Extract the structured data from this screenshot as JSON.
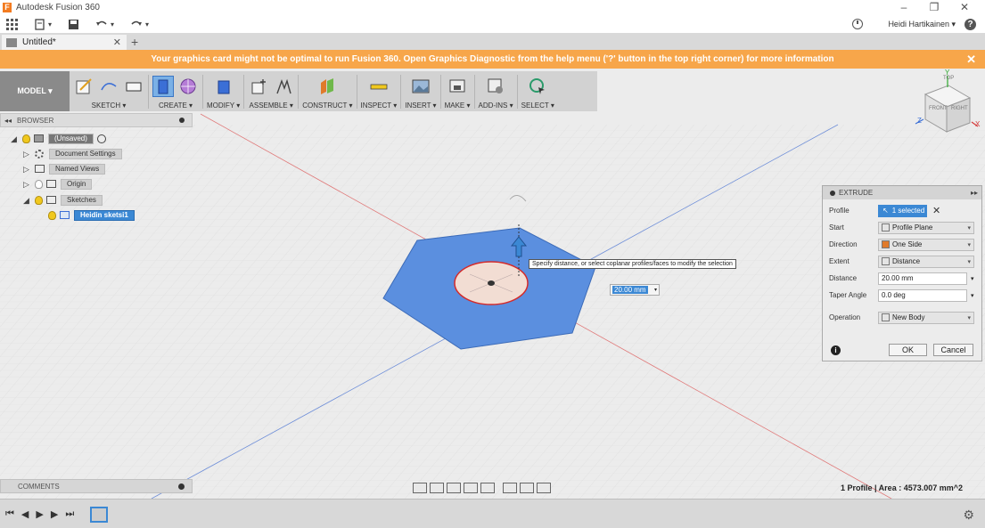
{
  "window": {
    "title": "Autodesk Fusion 360",
    "controls": [
      "–",
      "❐",
      "✕"
    ]
  },
  "qat": {
    "user_name": "Heidi Hartikainen ▾",
    "help": "?"
  },
  "tabs": {
    "doc_title": "Untitled*",
    "close": "✕",
    "new": "+"
  },
  "banner": {
    "message": "Your graphics card might not be optimal to run Fusion 360. Open Graphics Diagnostic from the help menu ('?' button in the top right corner) for more information",
    "close": "✕"
  },
  "toolbar": {
    "workspace": "MODEL ▾",
    "groups": [
      "SKETCH ▾",
      "CREATE ▾",
      "MODIFY ▾",
      "ASSEMBLE ▾",
      "CONSTRUCT ▾",
      "INSPECT ▾",
      "INSERT ▾",
      "MAKE ▾",
      "ADD-INS ▾",
      "SELECT ▾"
    ]
  },
  "browser": {
    "title": "BROWSER",
    "collapse": "◂◂",
    "items": [
      {
        "label": "(Unsaved)"
      },
      {
        "label": "Document Settings"
      },
      {
        "label": "Named Views"
      },
      {
        "label": "Origin"
      },
      {
        "label": "Sketches"
      },
      {
        "label": "Heidin sketsi1"
      }
    ]
  },
  "viewcube": {
    "faces": [
      "TOP",
      "FRONT",
      "RIGHT"
    ],
    "axes": [
      "Y",
      "Z",
      "X"
    ]
  },
  "canvas": {
    "tooltip": "Specify distance, or select coplanar profiles/faces to modify the selection",
    "distance_input": "20.00 mm"
  },
  "extrude": {
    "title": "EXTRUDE",
    "rows": [
      {
        "label": "Profile",
        "value": "1 selected"
      },
      {
        "label": "Start",
        "value": "Profile Plane"
      },
      {
        "label": "Direction",
        "value": "One Side"
      },
      {
        "label": "Extent",
        "value": "Distance"
      },
      {
        "label": "Distance",
        "value": "20.00 mm"
      },
      {
        "label": "Taper Angle",
        "value": "0.0 deg"
      },
      {
        "label": "Operation",
        "value": "New Body"
      }
    ],
    "ok": "OK",
    "cancel": "Cancel",
    "info": "i"
  },
  "comments": {
    "title": "COMMENTS"
  },
  "status": {
    "text": "1 Profile | Area : 4573.007 mm^2"
  },
  "timeline": {
    "controls": [
      "⏮",
      "◀",
      "▶",
      "▶",
      "⏭"
    ],
    "settings": "⚙"
  },
  "colors": {
    "banner": "#f7a64a",
    "selection_blue": "#3b88d4",
    "hexagon_fill": "#5b8fdf",
    "circle_fill": "#f2ddd3",
    "circle_edge": "#d42b2b"
  }
}
